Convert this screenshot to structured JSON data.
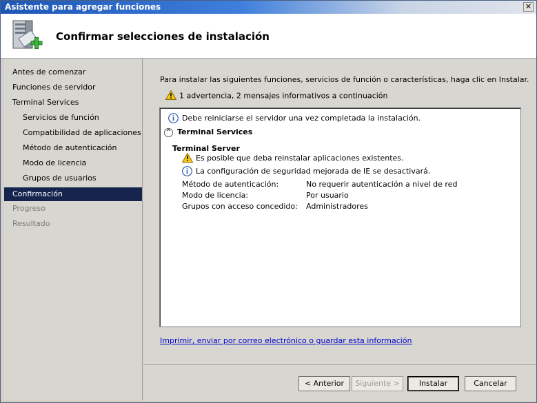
{
  "window": {
    "title": "Asistente para agregar funciones",
    "close_glyph": "✕"
  },
  "header": {
    "title": "Confirmar selecciones de instalación",
    "icon": "server-add-icon"
  },
  "sidebar": {
    "items": [
      {
        "label": "Antes de comenzar",
        "state": "normal"
      },
      {
        "label": "Funciones de servidor",
        "state": "normal"
      },
      {
        "label": "Terminal Services",
        "state": "normal"
      },
      {
        "label": "Servicios de función",
        "state": "sub"
      },
      {
        "label": "Compatibilidad de aplicaciones",
        "state": "sub"
      },
      {
        "label": "Método de autenticación",
        "state": "sub"
      },
      {
        "label": "Modo de licencia",
        "state": "sub"
      },
      {
        "label": "Grupos de usuarios",
        "state": "sub"
      },
      {
        "label": "Confirmación",
        "state": "active"
      },
      {
        "label": "Progreso",
        "state": "disabled"
      },
      {
        "label": "Resultado",
        "state": "disabled"
      }
    ]
  },
  "main": {
    "intro": "Para instalar las siguientes funciones, servicios de función o características, haga clic en Instalar.",
    "warning_summary": "1 advertencia, 2 mensajes informativos a continuación",
    "results": {
      "restart_notice": "Debe reiniciarse el servidor una vez completada la instalación.",
      "section_title": "Terminal Services",
      "subsection_title": "Terminal Server",
      "warning_msg": "Es posible que deba reinstalar aplicaciones existentes.",
      "info_msg": "La configuración de seguridad mejorada de IE se desactivará.",
      "details": [
        {
          "label": "Método de autenticación:",
          "value": "No requerir autenticación a nivel de red"
        },
        {
          "label": "Modo de licencia:",
          "value": "Por usuario"
        },
        {
          "label": "Grupos con acceso concedido:",
          "value": "Administradores"
        }
      ]
    },
    "link": "Imprimir, enviar por correo electrónico o guardar esta información"
  },
  "footer": {
    "back": "< Anterior",
    "next": "Siguiente >",
    "install": "Instalar",
    "cancel": "Cancelar"
  },
  "colors": {
    "active_nav": "#16254e",
    "link": "#0000cc",
    "warning": "#f5c518",
    "info": "#2a5db0"
  }
}
